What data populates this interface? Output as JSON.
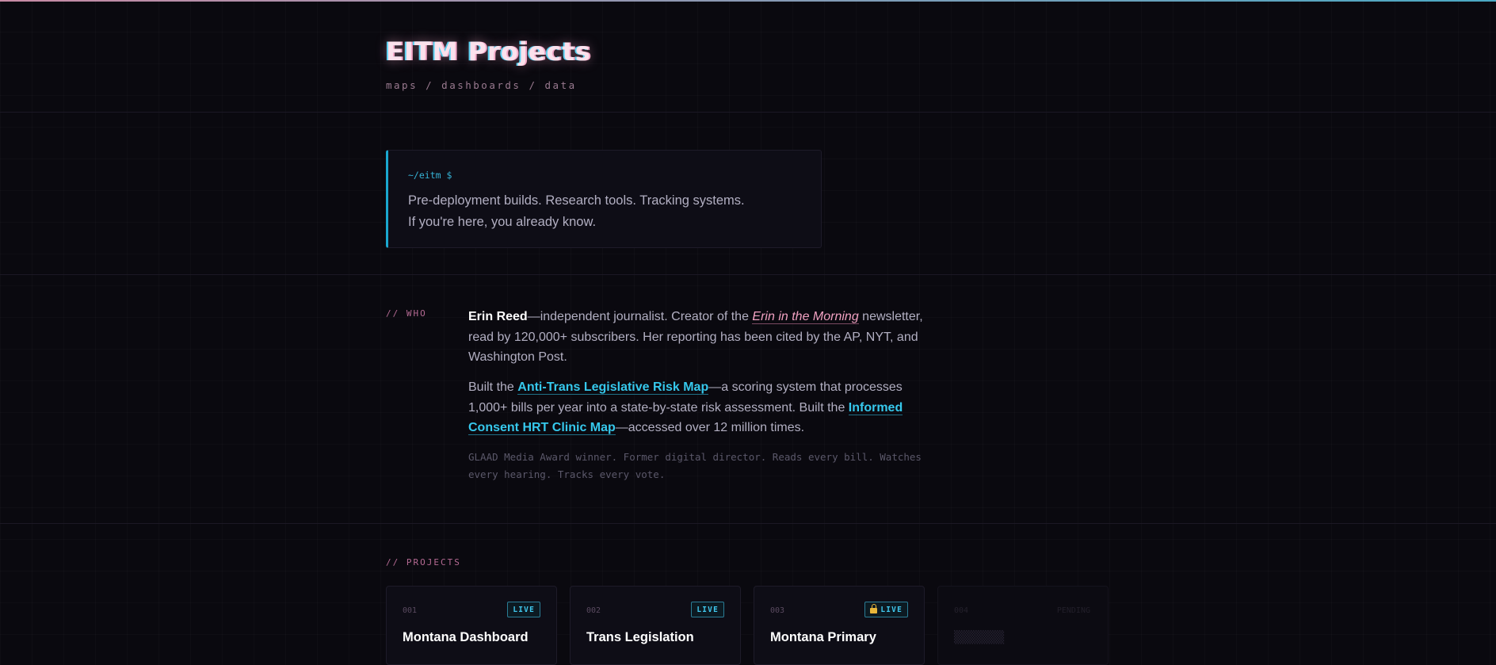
{
  "header": {
    "title": "EITM Projects",
    "subtitle": "maps / dashboards / data"
  },
  "terminal": {
    "prompt": "~/eitm $",
    "line1": "Pre-deployment builds. Research tools. Tracking systems.",
    "line2": "If you're here, you already know."
  },
  "who": {
    "label": "// WHO",
    "name": "Erin Reed",
    "p1_after_name": "—independent journalist. Creator of the ",
    "newsletter_link": "Erin in the Morning",
    "p1_rest": " newsletter, read by 120,000+ subscribers. Her reporting has been cited by the AP, NYT, and Washington Post.",
    "p2_built_the": "Built the ",
    "risk_map_link": "Anti-Trans Legislative Risk Map",
    "p2_mid": "—a scoring system that processes 1,000+ bills per year into a state-by-state risk assessment. Built the ",
    "clinic_map_link": "Informed Consent HRT Clinic Map",
    "p2_end": "—accessed over 12 million times.",
    "note": "GLAAD Media Award winner. Former digital director. Reads every bill. Watches every hearing. Tracks every vote."
  },
  "projects": {
    "label": "// PROJECTS",
    "cards": [
      {
        "num": "001",
        "badge": "LIVE",
        "locked": false,
        "name": "Montana Dashboard"
      },
      {
        "num": "002",
        "badge": "LIVE",
        "locked": false,
        "name": "Trans Legislation"
      },
      {
        "num": "003",
        "badge": "LIVE",
        "locked": true,
        "name": "Montana Primary"
      },
      {
        "num": "004",
        "badge": "PENDING",
        "locked": false,
        "name": "▒▒▒▒▒▒▒"
      }
    ]
  },
  "colors": {
    "background": "#0a090f",
    "accent_cyan": "#36c8ec",
    "accent_pink": "#f0a0c0",
    "label_pink": "#b56a93"
  }
}
